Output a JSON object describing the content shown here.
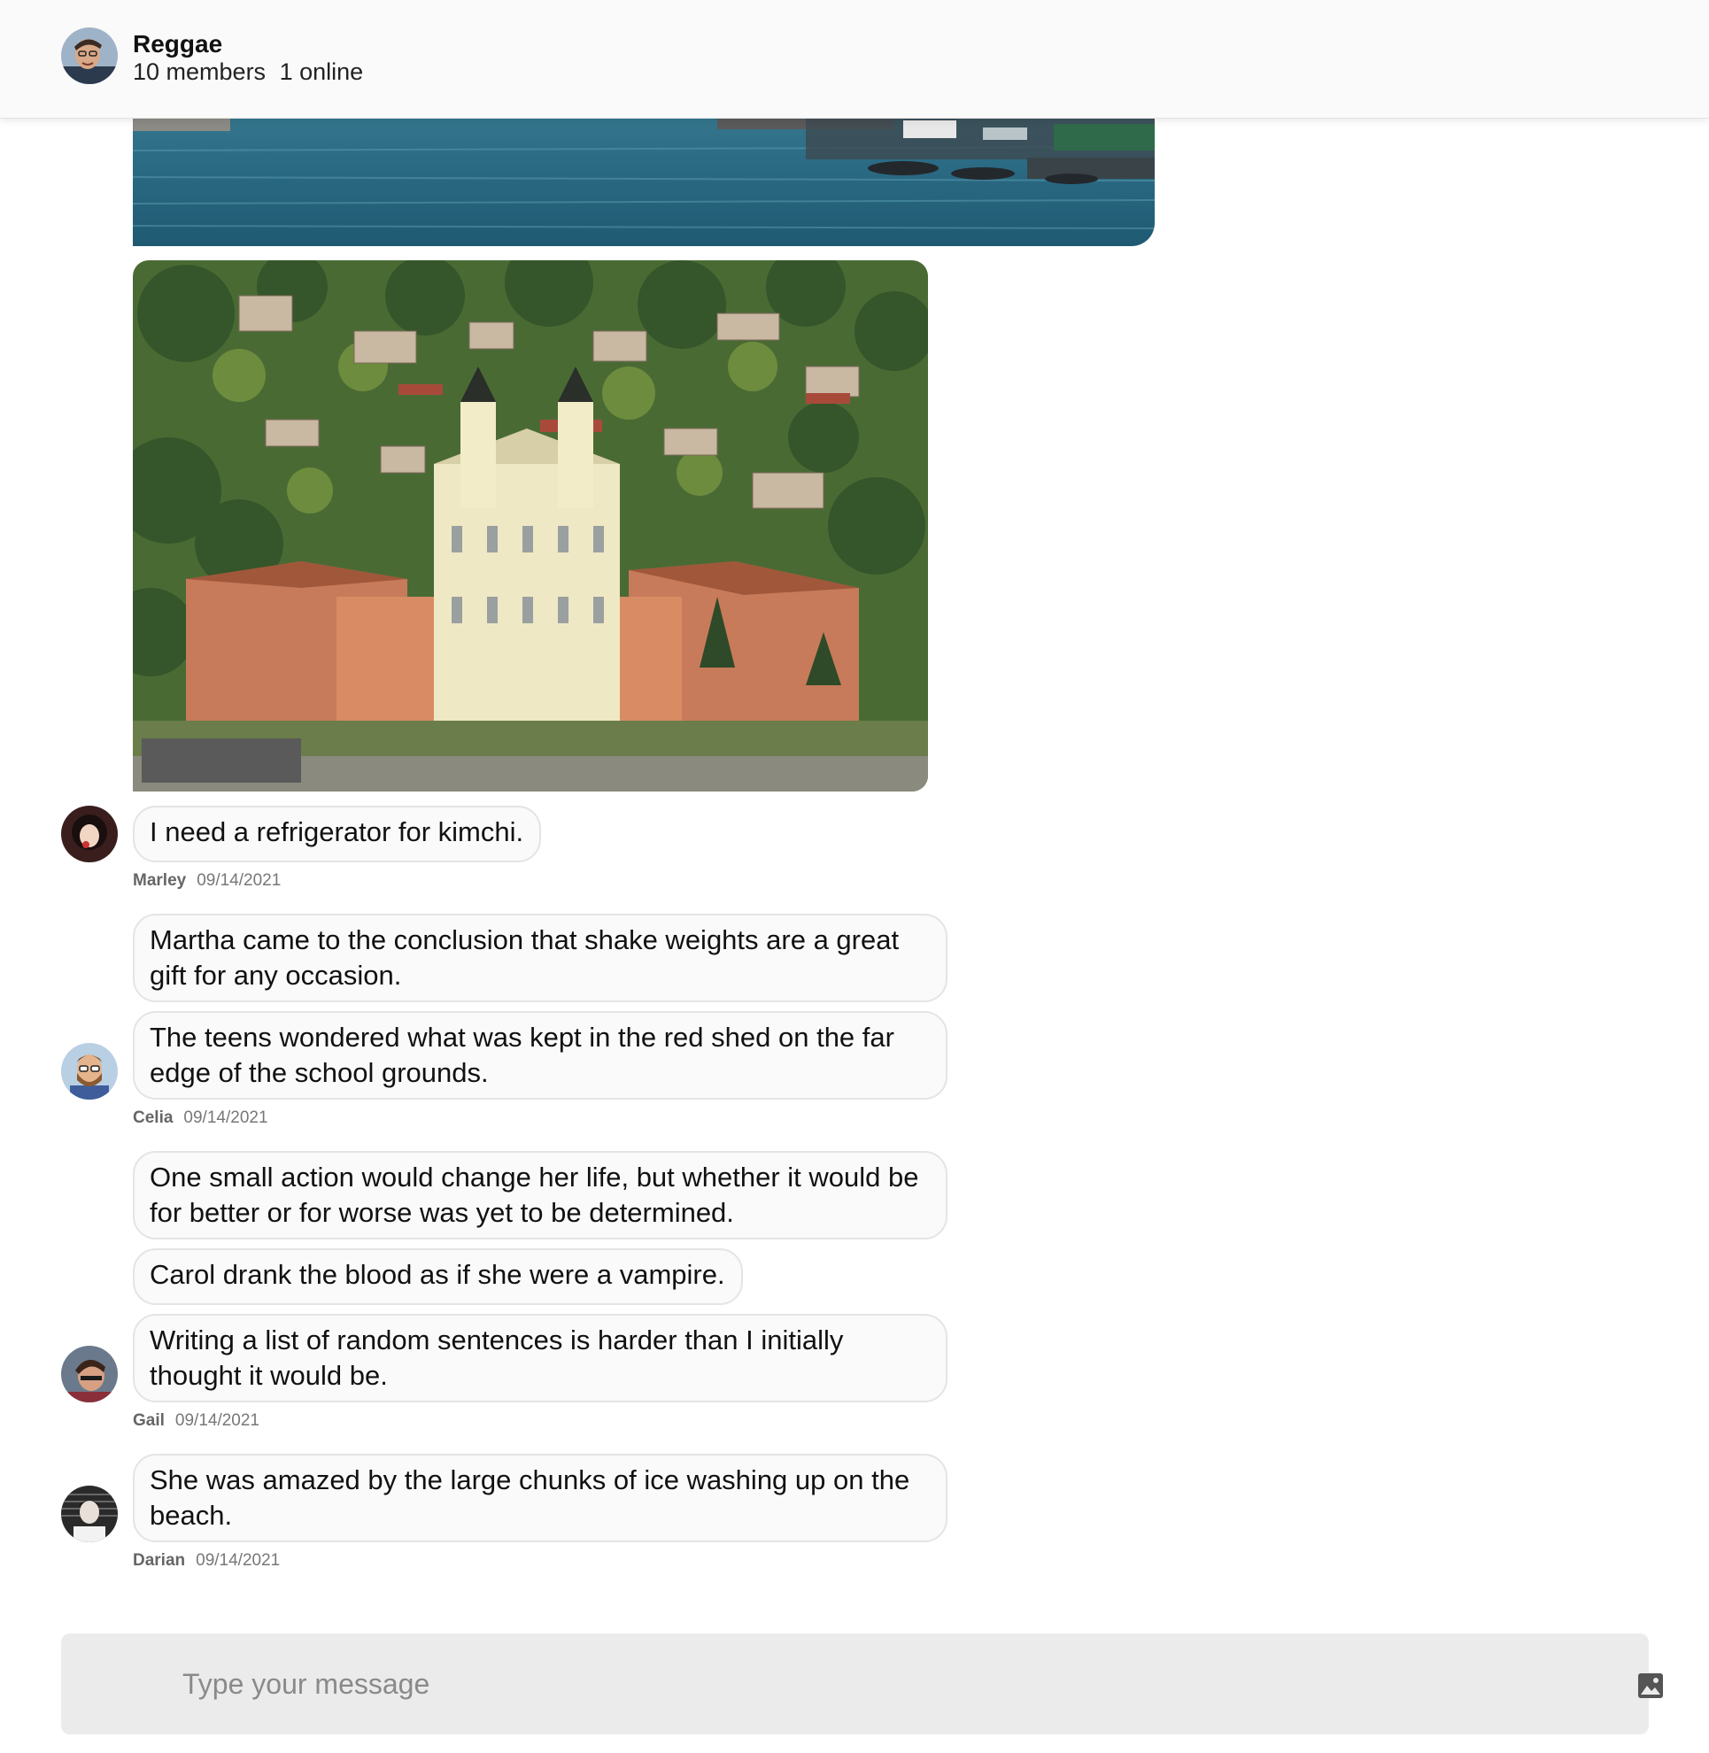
{
  "header": {
    "title": "Reggae",
    "members": "10 members",
    "online": "1 online"
  },
  "messages": [
    {
      "text": "I need a refrigerator for kimchi."
    },
    {
      "text": "Martha came to the conclusion that shake weights are a great gift for any occasion."
    },
    {
      "text": "The teens wondered what was kept in the red shed on the far edge of the school grounds."
    },
    {
      "text": "One small action would change her life, but whether it would be for better or for worse was yet to be determined."
    },
    {
      "text": "Carol drank the blood as if she were a vampire."
    },
    {
      "text": "Writing a list of random sentences is harder than I initially thought it would be."
    },
    {
      "text": "She was amazed by the large chunks of ice washing up on the beach."
    }
  ],
  "meta": [
    {
      "name": "Marley",
      "date": "09/14/2021"
    },
    {
      "name": "Celia",
      "date": "09/14/2021"
    },
    {
      "name": "Gail",
      "date": "09/14/2021"
    },
    {
      "name": "Darian",
      "date": "09/14/2021"
    }
  ],
  "composer": {
    "placeholder": "Type your message",
    "image_icon": "image-icon"
  }
}
